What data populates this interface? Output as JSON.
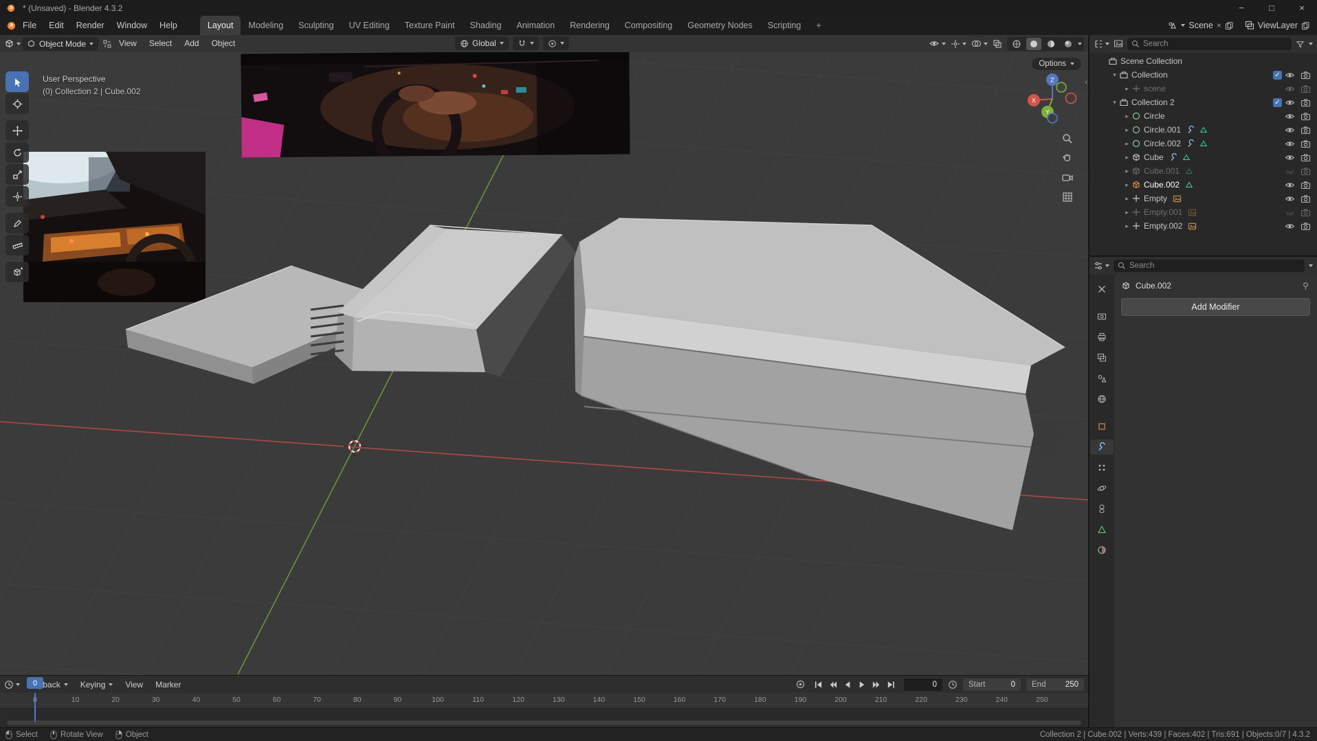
{
  "titlebar": {
    "title": "* (Unsaved) - Blender 4.3.2",
    "minimize": "−",
    "maximize": "□",
    "close": "×"
  },
  "topbar": {
    "menus": [
      "File",
      "Edit",
      "Render",
      "Window",
      "Help"
    ],
    "workspaces": [
      "Layout",
      "Modeling",
      "Sculpting",
      "UV Editing",
      "Texture Paint",
      "Shading",
      "Animation",
      "Rendering",
      "Compositing",
      "Geometry Nodes",
      "Scripting"
    ],
    "add_workspace": "+",
    "scene_label": "Scene",
    "view_layer_label": "ViewLayer"
  },
  "viewport_header": {
    "mode": "Object Mode",
    "menus": [
      "View",
      "Select",
      "Add",
      "Object"
    ],
    "orientation": "Global",
    "options_button": "Options"
  },
  "viewport": {
    "perspective_label": "User Perspective",
    "context_label": "(0) Collection 2 | Cube.002",
    "axis_x": "X",
    "axis_y": "Y",
    "axis_z": "Z"
  },
  "outliner": {
    "search_placeholder": "Search",
    "items": [
      {
        "label": "Scene Collection"
      },
      {
        "label": "Collection"
      },
      {
        "label": "scene"
      },
      {
        "label": "Collection 2"
      },
      {
        "label": "Circle"
      },
      {
        "label": "Circle.001"
      },
      {
        "label": "Circle.002"
      },
      {
        "label": "Cube"
      },
      {
        "label": "Cube.001"
      },
      {
        "label": "Cube.002"
      },
      {
        "label": "Empty"
      },
      {
        "label": "Empty.001"
      },
      {
        "label": "Empty.002"
      }
    ]
  },
  "properties": {
    "search_placeholder": "Search",
    "breadcrumb": "Cube.002",
    "add_modifier_button": "Add Modifier"
  },
  "timeline": {
    "menus": [
      "Playback",
      "Keying",
      "View",
      "Marker"
    ],
    "current_frame": "0",
    "start_label": "Start",
    "start_value": "0",
    "end_label": "End",
    "end_value": "250",
    "playhead_label": "0",
    "ticks": [
      "0",
      "10",
      "20",
      "30",
      "40",
      "50",
      "60",
      "70",
      "80",
      "90",
      "100",
      "110",
      "120",
      "130",
      "140",
      "150",
      "160",
      "170",
      "180",
      "190",
      "200",
      "210",
      "220",
      "230",
      "240",
      "250"
    ]
  },
  "statusbar": {
    "hints": [
      {
        "label": "Select"
      },
      {
        "label": "Rotate View"
      },
      {
        "label": "Object"
      }
    ],
    "stats": "Collection 2 | Cube.002 | Verts:439 | Faces:402 | Tris:691 | Objects:0/7 | 4.3.2"
  },
  "colors": {
    "accent": "#4772b3",
    "axis_x": "#bb4a44",
    "axis_y": "#71a33c",
    "axis_z": "#4a6fae"
  }
}
